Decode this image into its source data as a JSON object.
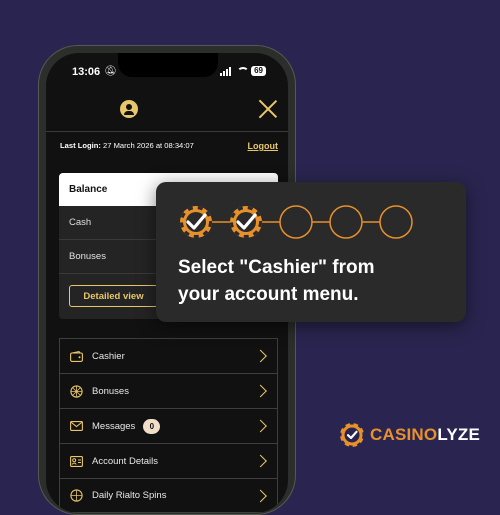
{
  "status_bar": {
    "time": "13:06",
    "battery": "69"
  },
  "account": {
    "last_login_label": "Last Login:",
    "last_login_value": "27 March 2026 at 08:34:07",
    "logout_label": "Logout"
  },
  "balance": {
    "title": "Balance",
    "rows": [
      {
        "label": "Cash"
      },
      {
        "label": "Bonuses"
      }
    ],
    "detailed_label": "Detailed view"
  },
  "menu": {
    "items": [
      {
        "label": "Cashier",
        "icon": "wallet-icon"
      },
      {
        "label": "Bonuses",
        "icon": "bonus-icon"
      },
      {
        "label": "Messages",
        "icon": "envelope-icon",
        "badge": "0"
      },
      {
        "label": "Account Details",
        "icon": "id-card-icon"
      },
      {
        "label": "Daily Rialto Spins",
        "icon": "spin-icon"
      }
    ]
  },
  "tutorial": {
    "steps_completed": 2,
    "steps_total": 5,
    "text_line1": "Select \"Cashier\" from",
    "text_line2": "your account menu."
  },
  "brand": {
    "logo_prefix": "CASINO",
    "logo_suffix": "LYZE",
    "accent": "#e8902a",
    "gold": "#e8c66a"
  }
}
